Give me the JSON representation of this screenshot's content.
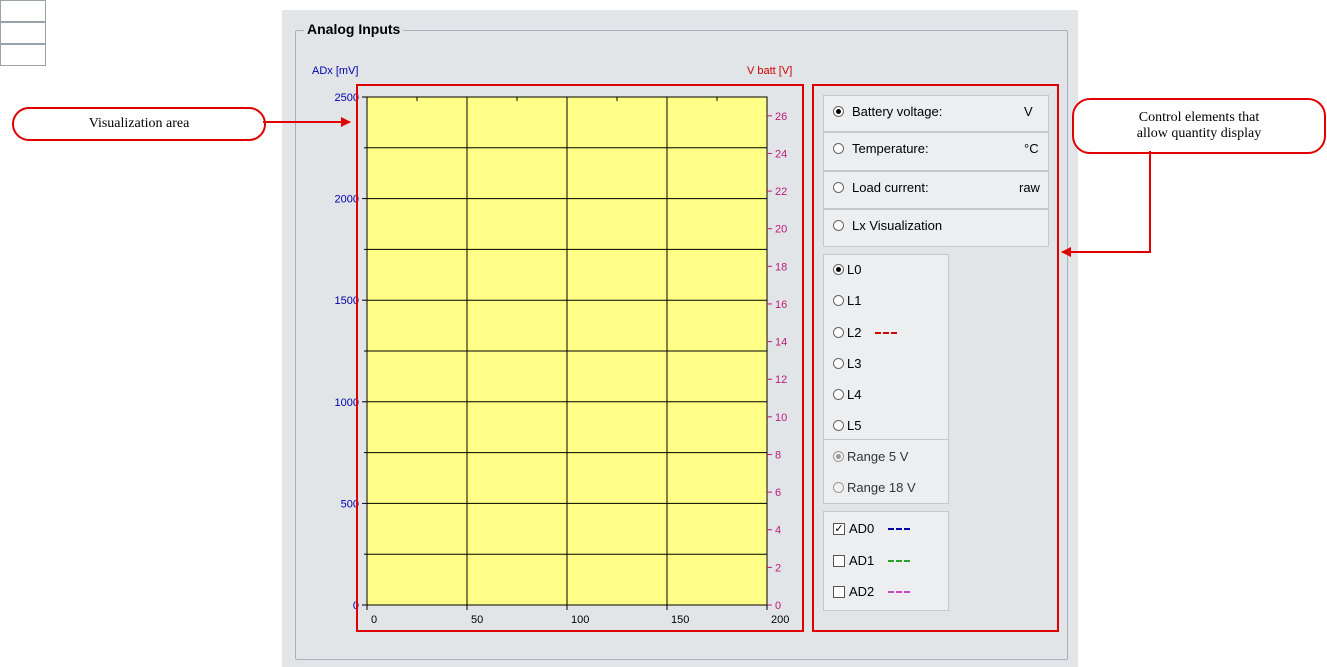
{
  "group": {
    "title": "Analog Inputs"
  },
  "axis": {
    "left_title": "ADx [mV]",
    "right_title": "V batt [V]",
    "left_ticks": [
      "2500",
      "2000",
      "1500",
      "1000",
      "500",
      "0"
    ],
    "right_ticks": [
      "26",
      "24",
      "22",
      "20",
      "18",
      "16",
      "14",
      "12",
      "10",
      "8",
      "6",
      "4",
      "2",
      "0"
    ],
    "x_ticks": [
      "0",
      "50",
      "100",
      "150",
      "200"
    ]
  },
  "chart_data": {
    "type": "line",
    "title": "",
    "xlabel": "",
    "ylabel": "ADx [mV]",
    "y2label": "V batt [V]",
    "xlim": [
      0,
      200
    ],
    "ylim": [
      0,
      2500
    ],
    "y2lim": [
      0,
      27
    ],
    "x_ticks": [
      0,
      50,
      100,
      150,
      200
    ],
    "y_ticks": [
      0,
      500,
      1000,
      1500,
      2000,
      2500
    ],
    "y2_ticks": [
      0,
      2,
      4,
      6,
      8,
      10,
      12,
      14,
      16,
      18,
      20,
      22,
      24,
      26
    ],
    "grid": true,
    "background": "#ffff88",
    "series": []
  },
  "controls": {
    "quantities": [
      {
        "label": "Battery voltage:",
        "unit": "V",
        "value": "",
        "selected": true,
        "has_field": true
      },
      {
        "label": "Temperature:",
        "unit": "°C",
        "value": "",
        "selected": false,
        "has_field": true
      },
      {
        "label": "Load current:",
        "unit": "raw",
        "value": "",
        "selected": false,
        "has_field": true
      },
      {
        "label": "Lx Visualization",
        "unit": "",
        "value": "",
        "selected": false,
        "has_field": false
      }
    ],
    "lx": [
      {
        "label": "L0",
        "selected": true,
        "dash_color": ""
      },
      {
        "label": "L1",
        "selected": false,
        "dash_color": ""
      },
      {
        "label": "L2",
        "selected": false,
        "dash_color": "#cc0000"
      },
      {
        "label": "L3",
        "selected": false,
        "dash_color": ""
      },
      {
        "label": "L4",
        "selected": false,
        "dash_color": ""
      },
      {
        "label": "L5",
        "selected": false,
        "dash_color": ""
      }
    ],
    "ranges": [
      {
        "label": "Range 5 V",
        "selected": true
      },
      {
        "label": "Range 18 V",
        "selected": false
      }
    ],
    "ad": [
      {
        "label": "AD0",
        "checked": true,
        "dash_color": "#0000aa"
      },
      {
        "label": "AD1",
        "checked": false,
        "dash_color": "#2ca02c"
      },
      {
        "label": "AD2",
        "checked": false,
        "dash_color": "#cc44cc"
      }
    ]
  },
  "callouts": {
    "visualization": "Visualization area",
    "controls_line1": "Control elements that",
    "controls_line2": "allow quantity display"
  },
  "colors": {
    "annotation": "#e00000",
    "plot_bg": "#ffff88",
    "panel_bg": "#e2e5e8"
  }
}
